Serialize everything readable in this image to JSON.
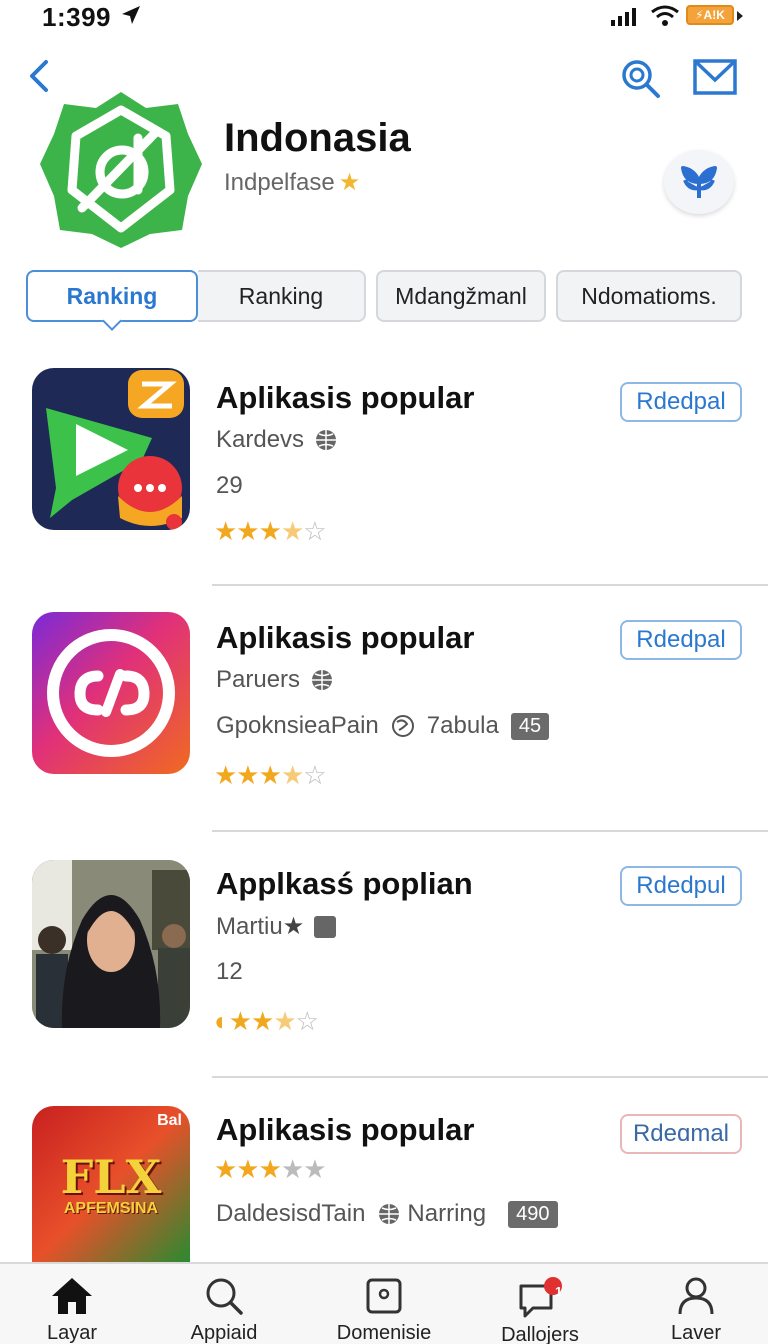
{
  "status": {
    "time": "1:399",
    "battery": "⚡A!K"
  },
  "header": {
    "app_title": "Indonasia",
    "app_subtitle": "Indpelfase"
  },
  "tabs": [
    {
      "label": "Ranking",
      "active": true
    },
    {
      "label": "Ranking",
      "active": false
    },
    {
      "label": "Mdangžmanl",
      "active": false
    },
    {
      "label": "Ndomatioms.",
      "active": false
    }
  ],
  "items": [
    {
      "title": "Aplikasis popular",
      "subtitle": "Kardevs",
      "meta": "29",
      "rating": 3.5,
      "button": "Rdedpal"
    },
    {
      "title": "Aplikasis popular",
      "subtitle": "Paruers",
      "meta": "GpoknsieaPain",
      "meta2": "7abula",
      "count": "45",
      "rating": 3.5,
      "button": "Rdedpal"
    },
    {
      "title": "Applkasś poplian",
      "subtitle": "Martiu",
      "meta": "12",
      "rating": 3.5,
      "button": "Rdedpul"
    },
    {
      "title": "Aplikasis popular",
      "subtitle": "DaldesisdTain",
      "meta2": "Narring",
      "count": "490",
      "rating": 3,
      "button": "Rdeɑmal",
      "thumb_text": "FLX",
      "thumb_subtext": "APFEMSINA",
      "thumb_corner": "Bal"
    }
  ],
  "tabbar": [
    {
      "label": "Layar",
      "icon": "home-icon"
    },
    {
      "label": "Appiaid",
      "icon": "search-icon"
    },
    {
      "label": "Domenisie",
      "icon": "screen-icon"
    },
    {
      "label": "Dallojers",
      "icon": "chat-icon",
      "badge": "1"
    },
    {
      "label": "Laver",
      "icon": "person-icon"
    }
  ],
  "colors": {
    "accent": "#2b78d0",
    "star": "#f2a81e",
    "app_green": "#3cb44a"
  }
}
